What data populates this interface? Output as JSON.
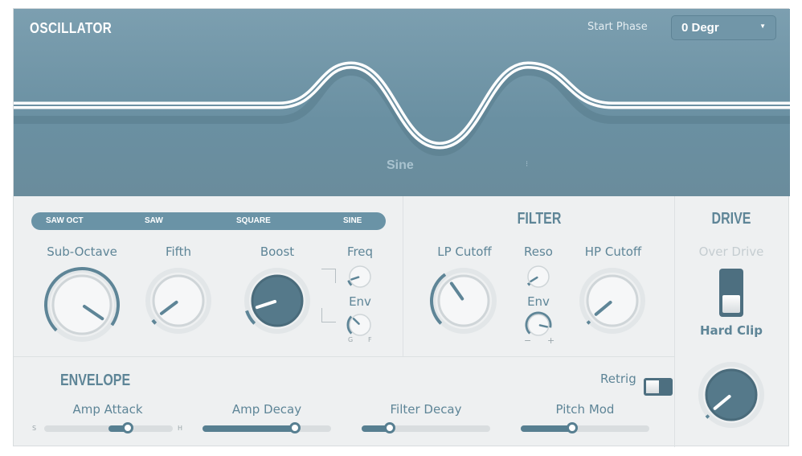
{
  "oscillator": {
    "title": "OSCILLATOR",
    "start_phase_label": "Start Phase",
    "start_phase_value": "0 Degr",
    "wave_name": "Sine",
    "wave_types": [
      "SAW OCT",
      "SAW",
      "SQUARE",
      "SINE"
    ],
    "knobs": [
      {
        "label": "Sub-Octave",
        "value": 0.96
      },
      {
        "label": "Fifth",
        "value": 0.03
      },
      {
        "label": "Boost",
        "value": 0.1
      }
    ],
    "freq": {
      "label": "Freq",
      "value": 0.1
    },
    "env": {
      "label": "Env",
      "value": 0.33,
      "min_label": "G",
      "max_label": "F"
    }
  },
  "filter": {
    "title": "FILTER",
    "lp": {
      "label": "LP Cutoff",
      "value": 0.37
    },
    "reso": {
      "label": "Reso",
      "value": 0.05
    },
    "env": {
      "label": "Env",
      "value": 0.88,
      "min_label": "−",
      "max_label": "+"
    },
    "hp": {
      "label": "HP Cutoff",
      "value": 0.02
    }
  },
  "drive": {
    "title": "DRIVE",
    "over_label": "Over Drive",
    "hard_label": "Hard Clip",
    "mode": "Hard Clip",
    "value": 0.02
  },
  "envelope": {
    "title": "ENVELOPE",
    "retrig_label": "Retrig",
    "retrig_on": false,
    "sliders": [
      {
        "label": "Amp Attack",
        "value": 0.65,
        "min_label": "S",
        "max_label": "H",
        "bipolar": true
      },
      {
        "label": "Amp Decay",
        "value": 0.72
      },
      {
        "label": "Filter Decay",
        "value": 0.22
      },
      {
        "label": "Pitch Mod",
        "value": 0.4
      }
    ]
  },
  "colors": {
    "accent": "#5e8597",
    "header": "#6e94a6"
  }
}
